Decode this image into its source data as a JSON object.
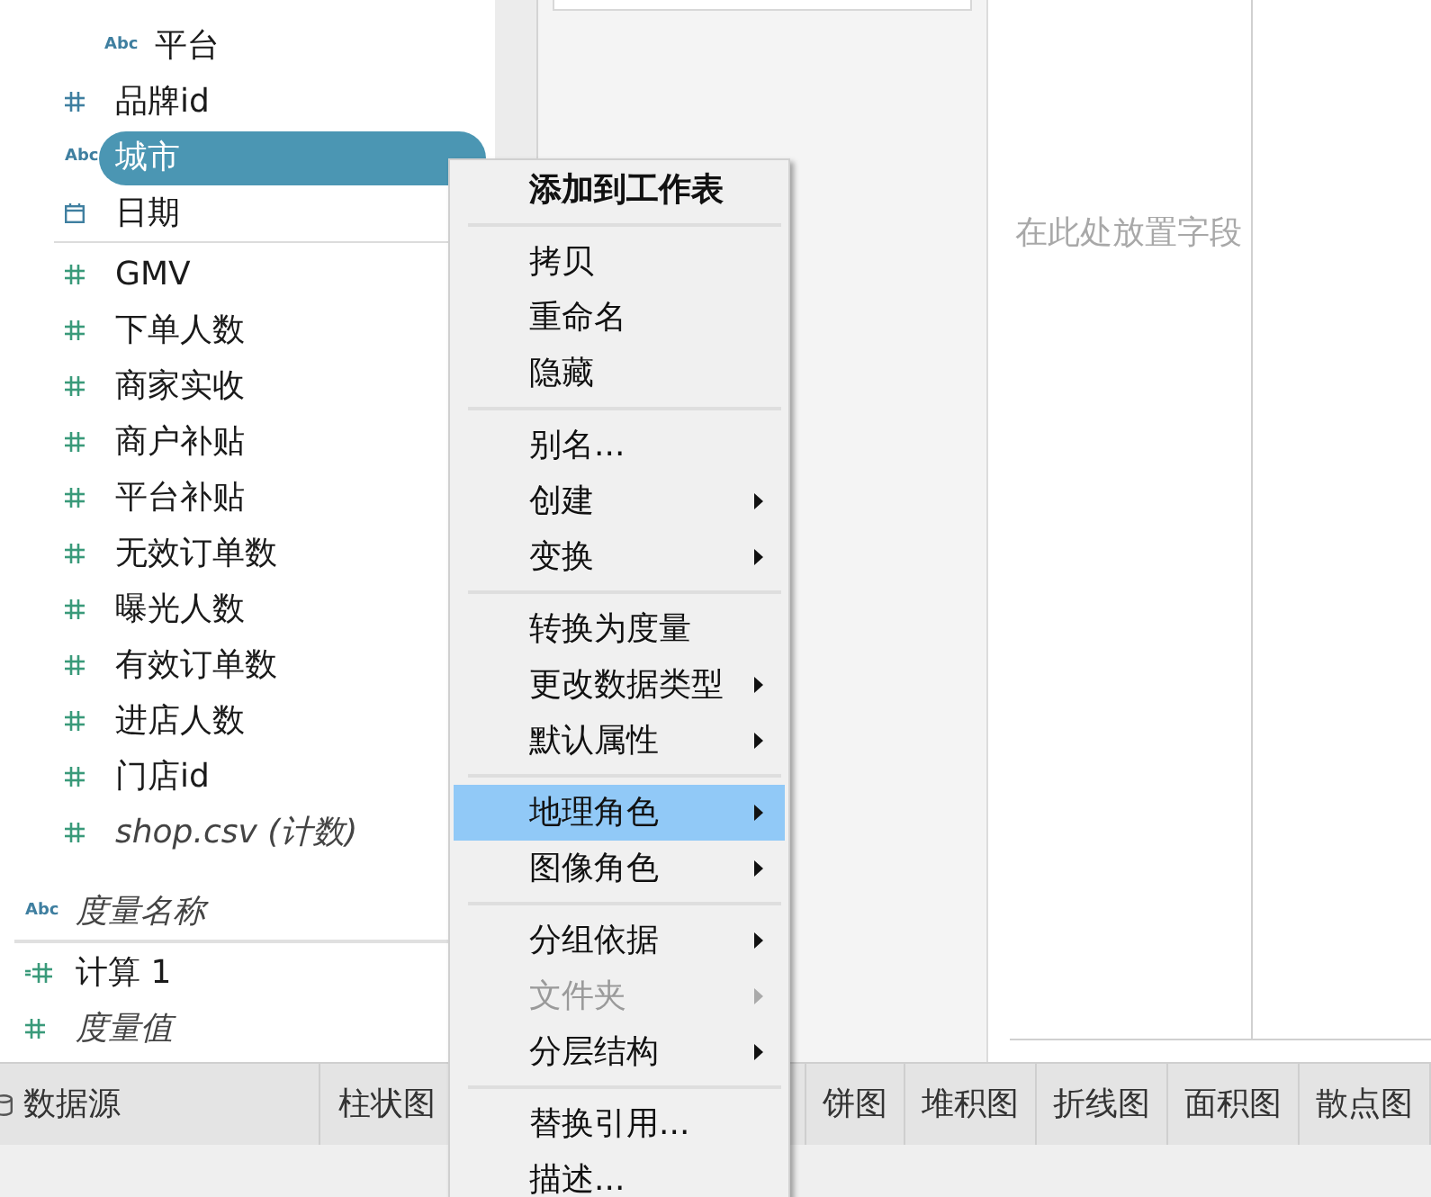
{
  "data_pane": {
    "table_blocks": [
      [
        {
          "kind": "folder",
          "children": [
            {
              "name": "平台",
              "kind": "string",
              "type_label": "Abc",
              "color": "#3f7fa0",
              "generated": false,
              "selected": false
            }
          ]
        },
        {
          "name": "品牌id",
          "kind": "number",
          "color": "#3f7fa0",
          "generated": false,
          "selected": false
        },
        {
          "name": "城市",
          "kind": "string",
          "type_label": "Abc",
          "color": "#3f7fa0",
          "generated": false,
          "selected": true
        },
        {
          "name": "日期",
          "kind": "date",
          "color": "#3f7fa0",
          "generated": false,
          "selected": false
        }
      ],
      [
        {
          "name": "GMV",
          "kind": "number",
          "color": "#3a9a7a",
          "generated": false,
          "selected": false
        },
        {
          "name": "下单人数",
          "kind": "number",
          "color": "#3a9a7a",
          "generated": false,
          "selected": false
        },
        {
          "name": "商家实收",
          "kind": "number",
          "color": "#3a9a7a",
          "generated": false,
          "selected": false
        },
        {
          "name": "商户补贴",
          "kind": "number",
          "color": "#3a9a7a",
          "generated": false,
          "selected": false
        },
        {
          "name": "平台补贴",
          "kind": "number",
          "color": "#3a9a7a",
          "generated": false,
          "selected": false
        },
        {
          "name": "无效订单数",
          "kind": "number",
          "color": "#3a9a7a",
          "generated": false,
          "selected": false
        },
        {
          "name": "曝光人数",
          "kind": "number",
          "color": "#3a9a7a",
          "generated": false,
          "selected": false
        },
        {
          "name": "有效订单数",
          "kind": "number",
          "color": "#3a9a7a",
          "generated": false,
          "selected": false
        },
        {
          "name": "进店人数",
          "kind": "number",
          "color": "#3a9a7a",
          "generated": false,
          "selected": false
        },
        {
          "name": "门店id",
          "kind": "number",
          "color": "#3a9a7a",
          "generated": false,
          "selected": false
        },
        {
          "name": "shop.csv (计数)",
          "kind": "number",
          "color": "#3a9a7a",
          "generated": true,
          "selected": false
        }
      ]
    ],
    "extra_blocks": [
      [
        {
          "name": "度量名称",
          "kind": "string",
          "type_label": "Abc",
          "color": "#3f7fa0",
          "generated": true,
          "selected": false
        }
      ],
      [
        {
          "name": "计算 1",
          "kind": "calc",
          "color": "#3a9a7a",
          "generated": false,
          "selected": false
        },
        {
          "name": "度量值",
          "kind": "number",
          "color": "#3a9a7a",
          "generated": true,
          "selected": false
        }
      ]
    ]
  },
  "canvas": {
    "placeholder": "在此处放置字段"
  },
  "context_menu": {
    "groups": [
      [
        {
          "label": "添加到工作表",
          "kind": "default",
          "highlighted": false,
          "disabled": false
        }
      ],
      [
        {
          "label": "拷贝",
          "kind": "command",
          "highlighted": false,
          "disabled": false
        },
        {
          "label": "重命名",
          "kind": "command",
          "highlighted": false,
          "disabled": false
        },
        {
          "label": "隐藏",
          "kind": "command",
          "highlighted": false,
          "disabled": false
        }
      ],
      [
        {
          "label": "别名...",
          "kind": "command",
          "highlighted": false,
          "disabled": false
        },
        {
          "label": "创建",
          "kind": "submenu",
          "highlighted": false,
          "disabled": false
        },
        {
          "label": "变换",
          "kind": "submenu",
          "highlighted": false,
          "disabled": false
        }
      ],
      [
        {
          "label": "转换为度量",
          "kind": "command",
          "highlighted": false,
          "disabled": false
        },
        {
          "label": "更改数据类型",
          "kind": "submenu",
          "highlighted": false,
          "disabled": false
        },
        {
          "label": "默认属性",
          "kind": "submenu",
          "highlighted": false,
          "disabled": false
        }
      ],
      [
        {
          "label": "地理角色",
          "kind": "submenu",
          "highlighted": true,
          "disabled": false
        },
        {
          "label": "图像角色",
          "kind": "submenu",
          "highlighted": false,
          "disabled": false
        }
      ],
      [
        {
          "label": "分组依据",
          "kind": "submenu",
          "highlighted": false,
          "disabled": false
        },
        {
          "label": "文件夹",
          "kind": "submenu",
          "highlighted": false,
          "disabled": true
        },
        {
          "label": "分层结构",
          "kind": "submenu",
          "highlighted": false,
          "disabled": false
        }
      ],
      [
        {
          "label": "替换引用...",
          "kind": "command",
          "highlighted": false,
          "disabled": false
        },
        {
          "label": "描述...",
          "kind": "command",
          "highlighted": false,
          "disabled": false
        }
      ]
    ]
  },
  "sheet_tabs": [
    {
      "label": "数据源",
      "kind": "datasource",
      "selected": false
    },
    {
      "label": "柱状图",
      "kind": "sheet",
      "selected": false
    },
    {
      "label": "饼图",
      "kind": "sheet",
      "selected": false
    },
    {
      "label": "堆积图",
      "kind": "sheet",
      "selected": false
    },
    {
      "label": "折线图",
      "kind": "sheet",
      "selected": false
    },
    {
      "label": "面积图",
      "kind": "sheet",
      "selected": false
    },
    {
      "label": "散点图",
      "kind": "sheet",
      "selected": false
    }
  ]
}
